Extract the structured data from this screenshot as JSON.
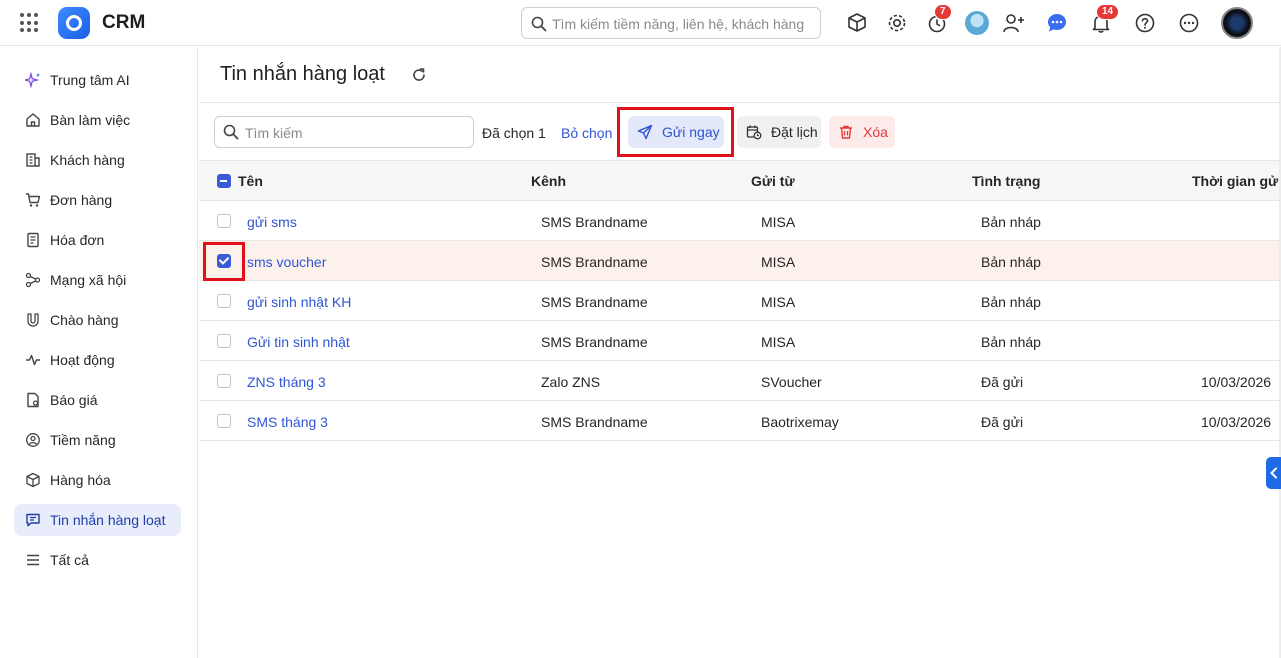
{
  "app": {
    "brand": "CRM",
    "search_placeholder": "Tìm kiếm tiềm năng, liên hệ, khách hàng"
  },
  "topbar": {
    "icons": [
      "apps-grid-icon",
      "box-search-icon",
      "gear-icon",
      "timer-icon",
      "avatar-small",
      "add-user-icon",
      "chat-icon",
      "bell-icon",
      "help-icon",
      "more-icon",
      "user-avatar"
    ],
    "timer_badge": "7",
    "bell_badge": "14"
  },
  "sidebar": {
    "items": [
      {
        "label": "Trung tâm AI",
        "icon": "sparkle-icon"
      },
      {
        "label": "Bàn làm việc",
        "icon": "home-icon"
      },
      {
        "label": "Khách hàng",
        "icon": "building-icon"
      },
      {
        "label": "Đơn hàng",
        "icon": "cart-icon"
      },
      {
        "label": "Hóa đơn",
        "icon": "invoice-icon"
      },
      {
        "label": "Mạng xã hội",
        "icon": "social-icon"
      },
      {
        "label": "Chào hàng",
        "icon": "magnet-icon"
      },
      {
        "label": "Hoạt động",
        "icon": "activity-icon"
      },
      {
        "label": "Báo giá",
        "icon": "quote-icon"
      },
      {
        "label": "Tiềm năng",
        "icon": "target-icon"
      },
      {
        "label": "Hàng hóa",
        "icon": "cube-icon"
      },
      {
        "label": "Tin nhắn hàng loạt",
        "icon": "message-icon",
        "active": true
      },
      {
        "label": "Tất cả",
        "icon": "menu-icon"
      }
    ]
  },
  "page": {
    "title": "Tin nhắn hàng loạt"
  },
  "toolbar": {
    "search_placeholder": "Tìm kiếm",
    "selected_text": "Đã chọn 1",
    "deselect_label": "Bỏ chọn",
    "send_now_label": "Gửi ngay",
    "schedule_label": "Đặt lịch",
    "delete_label": "Xóa"
  },
  "table": {
    "columns": [
      "Tên",
      "Kênh",
      "Gửi từ",
      "Tình trạng",
      "Thời gian gửi"
    ],
    "rows": [
      {
        "name": "gửi sms",
        "channel": "SMS Brandname",
        "sender": "MISA",
        "status": "Bản nháp",
        "time": "",
        "checked": false
      },
      {
        "name": "sms voucher",
        "channel": "SMS Brandname",
        "sender": "MISA",
        "status": "Bản nháp",
        "time": "",
        "checked": true
      },
      {
        "name": "gửi sinh nhật KH",
        "channel": "SMS Brandname",
        "sender": "MISA",
        "status": "Bản nháp",
        "time": "",
        "checked": false
      },
      {
        "name": "Gửi tin sinh nhật",
        "channel": "SMS Brandname",
        "sender": "MISA",
        "status": "Bản nháp",
        "time": "",
        "checked": false
      },
      {
        "name": "ZNS tháng 3",
        "channel": "Zalo ZNS",
        "sender": "SVoucher",
        "status": "Đã gửi",
        "time": "10/03/2026",
        "checked": false
      },
      {
        "name": "SMS tháng 3",
        "channel": "SMS Brandname",
        "sender": "Baotrixemay",
        "status": "Đã gửi",
        "time": "10/03/2026",
        "checked": false
      }
    ]
  },
  "colors": {
    "accent": "#2f55d4",
    "danger": "#e53935",
    "highlight": "#e0101a",
    "selected_row": "#fdf1ec"
  }
}
